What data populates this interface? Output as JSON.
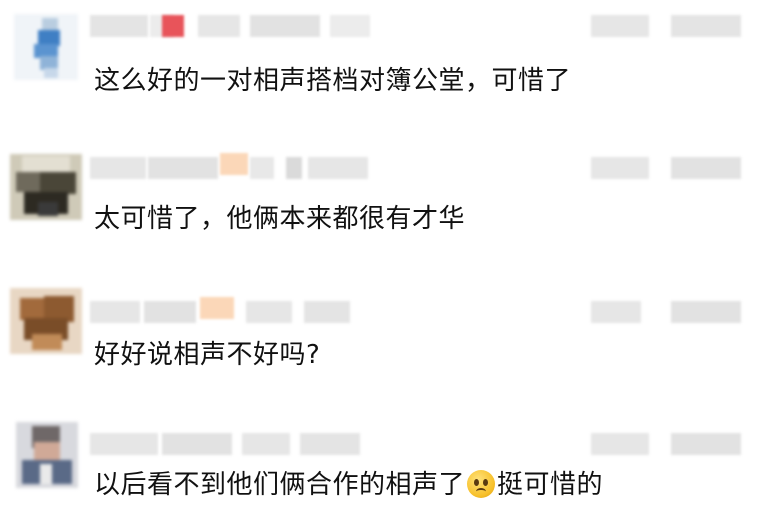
{
  "comments": [
    {
      "avatar": "blurred-avatar",
      "text_before": "这么好的一对相声搭档对簿公堂，可惜了",
      "emoji": "",
      "text_after": ""
    },
    {
      "avatar": "blurred-avatar",
      "text_before": "太可惜了，他俩本来都很有才华",
      "emoji": "",
      "text_after": ""
    },
    {
      "avatar": "blurred-avatar",
      "text_before": "好好说相声不好吗?",
      "emoji": "",
      "text_after": ""
    },
    {
      "avatar": "blurred-avatar",
      "text_before": "以后看不到他们俩合作的相声了",
      "emoji": "frowning-face-emoji",
      "text_after": "挺可惜的"
    }
  ],
  "colors": {
    "text": "#111111",
    "blur_gray": "#e2e2e2",
    "background": "#ffffff"
  }
}
